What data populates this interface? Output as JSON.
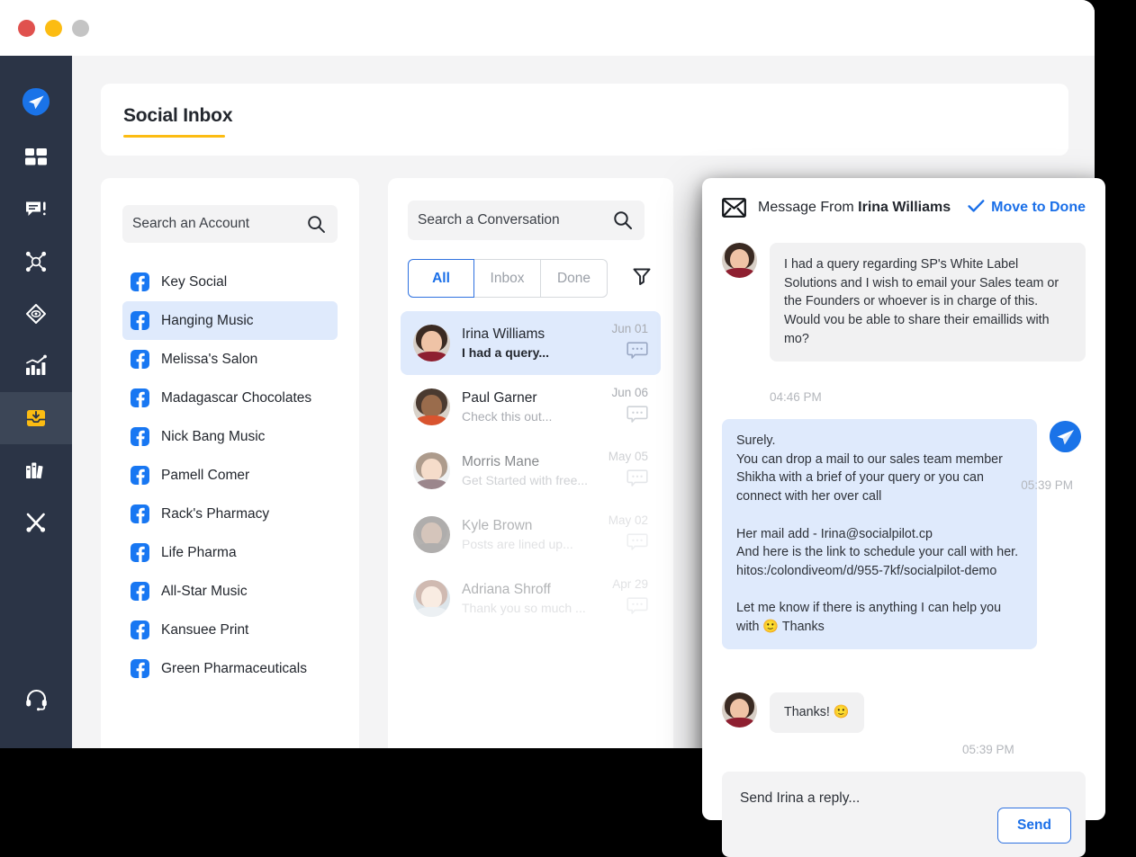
{
  "window": {
    "traffic_lights": [
      {
        "name": "close",
        "color": "#e0514e"
      },
      {
        "name": "minimize",
        "color": "#fcbc12"
      },
      {
        "name": "maximize",
        "color": "#c4c4c4"
      }
    ]
  },
  "colors": {
    "sidebar_bg": "#2b3446",
    "sidebar_active_bg": "#3c4657",
    "accent_blue": "#1a6fe8",
    "accent_yellow": "#fcbc12",
    "facebook_blue": "#1877f2",
    "selected_row_bg": "#dfeafc",
    "content_bg": "#f4f4f5"
  },
  "sidebar": {
    "items": [
      {
        "icon": "paper-plane-logo-icon",
        "active": false
      },
      {
        "icon": "dashboard-grid-icon",
        "active": false
      },
      {
        "icon": "posts-comment-icon",
        "active": false
      },
      {
        "icon": "network-share-icon",
        "active": false
      },
      {
        "icon": "eye-discovery-icon",
        "active": false
      },
      {
        "icon": "analytics-bar-chart-icon",
        "active": false
      },
      {
        "icon": "social-inbox-tray-icon",
        "active": true
      },
      {
        "icon": "content-library-books-icon",
        "active": false
      },
      {
        "icon": "tools-wrench-icon",
        "active": false
      }
    ],
    "footer": {
      "icon": "support-headset-icon"
    }
  },
  "header": {
    "title": "Social Inbox"
  },
  "accounts_panel": {
    "search": {
      "placeholder": "Search an Account",
      "icon": "search-icon"
    },
    "items": [
      {
        "name": "Key Social",
        "network": "facebook",
        "selected": false
      },
      {
        "name": "Hanging Music",
        "network": "facebook",
        "selected": true
      },
      {
        "name": "Melissa's Salon",
        "network": "facebook",
        "selected": false
      },
      {
        "name": "Madagascar Chocolates",
        "network": "facebook",
        "selected": false
      },
      {
        "name": "Nick Bang Music",
        "network": "facebook",
        "selected": false
      },
      {
        "name": "Pamell Comer",
        "network": "facebook",
        "selected": false
      },
      {
        "name": "Rack's Pharmacy",
        "network": "facebook",
        "selected": false
      },
      {
        "name": "Life Pharma",
        "network": "facebook",
        "selected": false
      },
      {
        "name": "All-Star Music",
        "network": "facebook",
        "selected": false
      },
      {
        "name": "Kansuee Print",
        "network": "facebook",
        "selected": false
      },
      {
        "name": "Green Pharmaceuticals",
        "network": "facebook",
        "selected": false
      }
    ]
  },
  "conversations_panel": {
    "search": {
      "placeholder": "Search a Conversation",
      "icon": "search-icon"
    },
    "tabs": [
      {
        "label": "All",
        "active": true
      },
      {
        "label": "Inbox",
        "active": false
      },
      {
        "label": "Done",
        "active": false
      }
    ],
    "filter_icon": "filter-funnel-icon",
    "items": [
      {
        "name": "Irina Williams",
        "preview": "I had a query...",
        "date": "Jun 01",
        "selected": true,
        "badge_icon": "comment-bubble-icon"
      },
      {
        "name": "Paul Garner",
        "preview": "Check this out...",
        "date": "Jun 06",
        "selected": false,
        "badge_icon": "comment-bubble-icon"
      },
      {
        "name": "Morris Mane",
        "preview": "Get Started with free...",
        "date": "May 05",
        "selected": false,
        "badge_icon": "comment-bubble-icon"
      },
      {
        "name": "Kyle Brown",
        "preview": "Posts are lined up...",
        "date": "May 02",
        "selected": false,
        "badge_icon": "comment-bubble-icon"
      },
      {
        "name": "Adriana Shroff",
        "preview": "Thank you so much ...",
        "date": "Apr 29",
        "selected": false,
        "badge_icon": "comment-bubble-icon"
      }
    ]
  },
  "message_panel": {
    "header": {
      "envelope_icon": "envelope-icon",
      "prefix": "Message From ",
      "sender": "Irina Williams",
      "action": {
        "label": "Move to Done",
        "icon": "check-icon"
      }
    },
    "messages": [
      {
        "direction": "incoming",
        "author": "Irina Williams",
        "text": "I had a query regarding SP's White Label Solutions and I wish to email your Sales team or the Founders or whoever is in charge of this. Would vou be able to share their emaillids with mo?",
        "time": "04:46 PM"
      },
      {
        "direction": "outgoing",
        "text": "Surely.\nYou can drop a mail to our sales team member Shikha with a brief of your query or you can connect with her over call\n\nHer mail add - Irina@socialpilot.cp\nAnd here is the link to schedule your call with her. hitos:/colondiveom/d/955-7kf/socialpilot-demo\n\nLet me know if there is anything I can help you with 🙂 Thanks",
        "time": "05:39 PM",
        "badge_icon": "paper-plane-icon"
      },
      {
        "direction": "incoming",
        "author": "Irina Williams",
        "text": "Thanks! 🙂",
        "time": "05:39 PM"
      }
    ],
    "reply": {
      "placeholder": "Send Irina a reply...",
      "send_label": "Send"
    }
  }
}
